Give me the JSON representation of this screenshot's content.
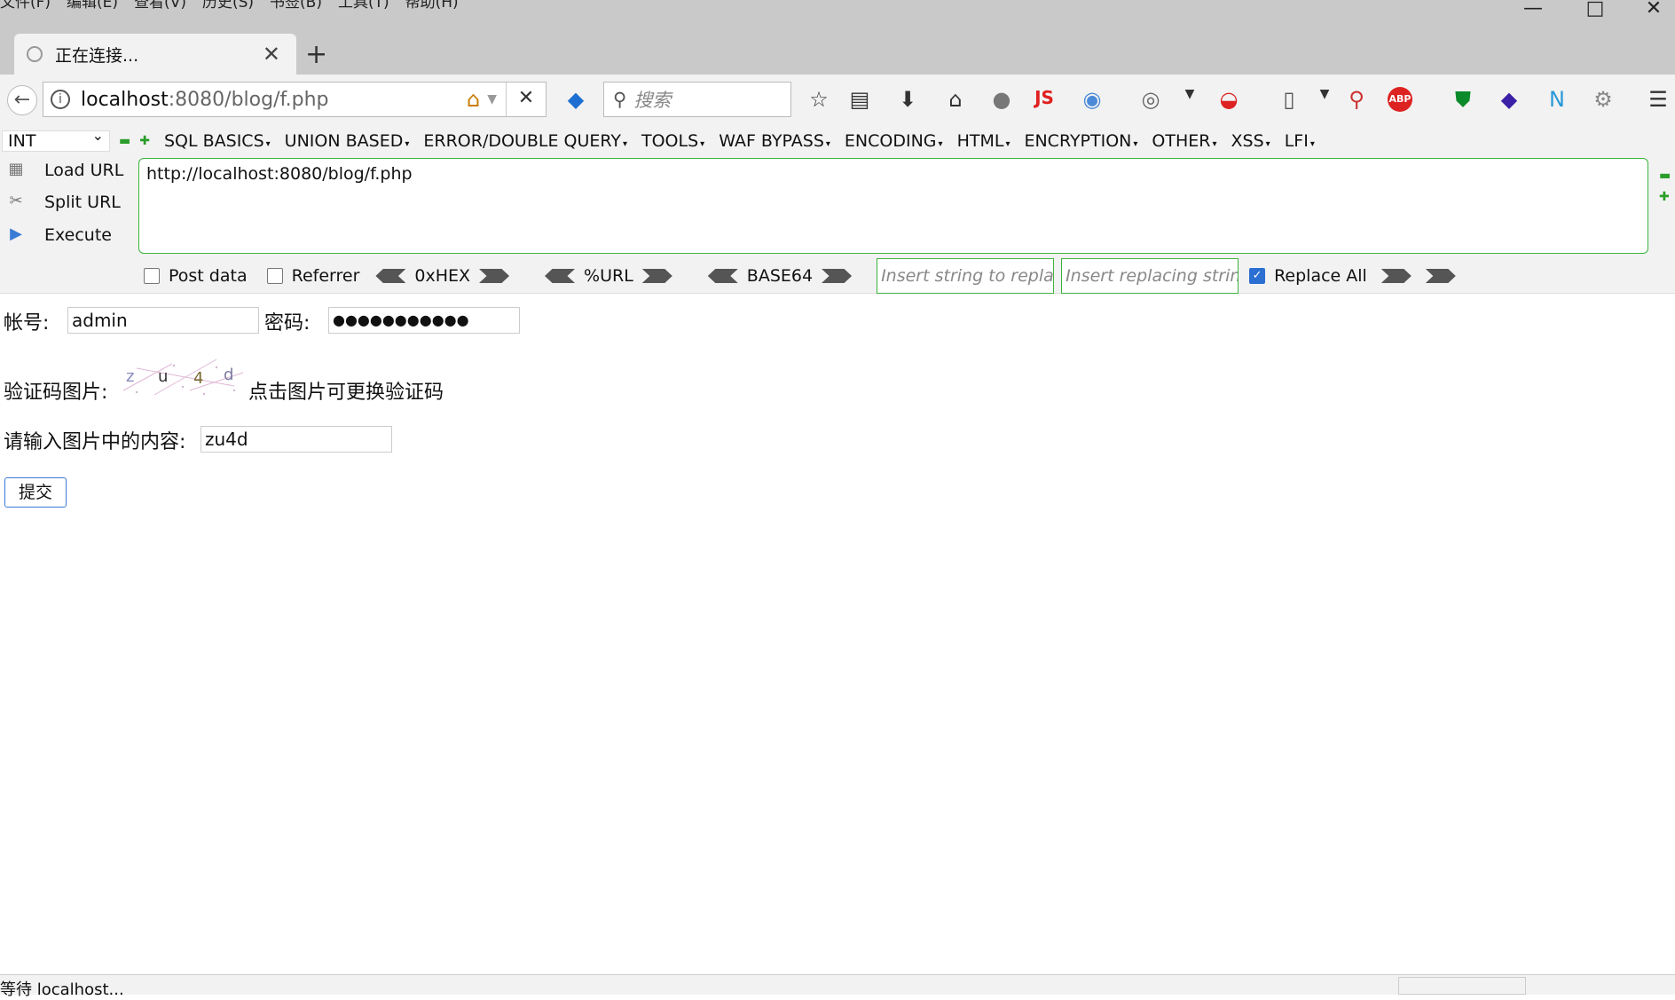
{
  "menubar": [
    "文件(F)",
    "编辑(E)",
    "查看(V)",
    "历史(S)",
    "书签(B)",
    "工具(T)",
    "帮助(H)"
  ],
  "window_controls": {
    "minimize": "—",
    "maximize": "□",
    "close": "✕"
  },
  "tab": {
    "title": "正在连接...",
    "close": "✕",
    "new_tab": "+"
  },
  "nav": {
    "back": "←",
    "url_host": "localhost",
    "url_rest": ":8080/blog/f.php",
    "home_icon": "home-icon",
    "stop": "✕",
    "search_placeholder": "搜索"
  },
  "toolbar_icons": [
    "bookmark-star-icon",
    "reading-list-icon",
    "download-icon",
    "home-icon",
    "globe-icon",
    "js-icon",
    "google-icon",
    "palette-icon",
    "dropdown-icon",
    "shield-red-icon",
    "layout-icon",
    "zoom-icon",
    "abp-icon",
    "green-shield-icon",
    "cube-icon",
    "nord-icon",
    "gear-icon"
  ],
  "hackbar": {
    "type_select": "INT",
    "menus": [
      "SQL BASICS",
      "UNION BASED",
      "ERROR/DOUBLE QUERY",
      "TOOLS",
      "WAF BYPASS",
      "ENCODING",
      "HTML",
      "ENCRYPTION",
      "OTHER",
      "XSS",
      "LFI"
    ],
    "load_url": "Load URL",
    "split_url": "Split URL",
    "execute": "Execute",
    "url_value": "http://localhost:8080/blog/f.php",
    "post_data": "Post data",
    "referrer": "Referrer",
    "hex": "0xHEX",
    "url_enc": "%URL",
    "base64": "BASE64",
    "replace_from_placeholder": "Insert string to replace",
    "replace_to_placeholder": "Insert replacing string",
    "replace_all": "Replace All"
  },
  "form": {
    "account_label": "帐号:",
    "account_value": "admin",
    "password_label": "密码:",
    "password_value": "●●●●●●●●●●●",
    "captcha_label": "验证码图片:",
    "captcha_text": "zu4d",
    "captcha_hint": "点击图片可更换验证码",
    "input_label": "请输入图片中的内容:",
    "input_value": "zu4d",
    "submit": "提交"
  },
  "status": {
    "text": "等待 localhost..."
  },
  "colors": {
    "hackbar_green": "#3cb43c",
    "chrome_gray": "#c9c9c9",
    "toolbar_bg": "#f2f2f2",
    "submit_border": "#3a7bd5"
  }
}
